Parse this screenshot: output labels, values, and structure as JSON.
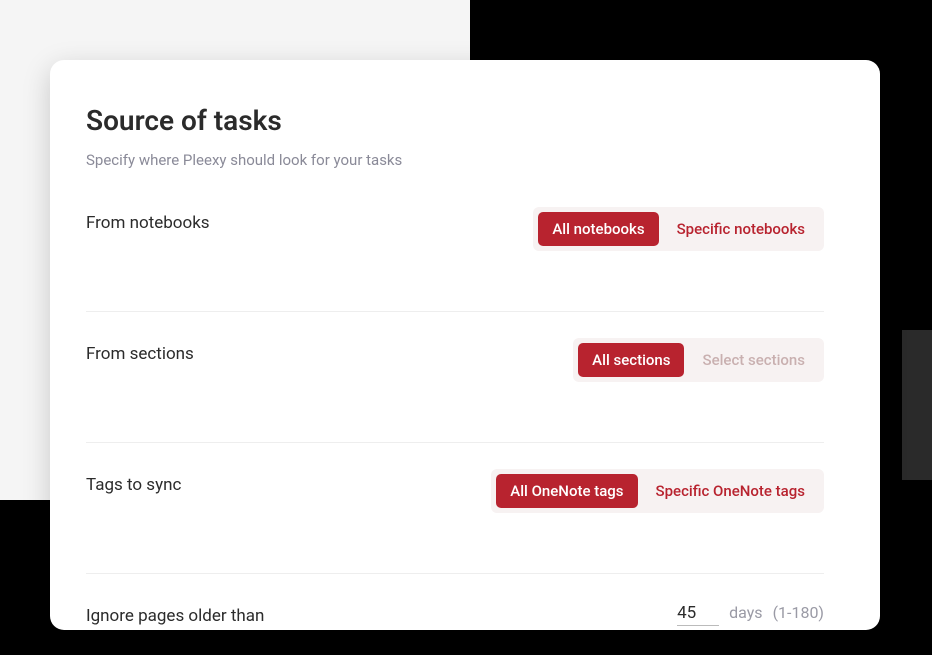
{
  "header": {
    "title": "Source of tasks",
    "subtitle": "Specify where Pleexy should look for your tasks"
  },
  "settings": {
    "notebooks": {
      "label": "From notebooks",
      "option_all": "All notebooks",
      "option_specific": "Specific notebooks"
    },
    "sections": {
      "label": "From sections",
      "option_all": "All sections",
      "option_specific": "Select sections"
    },
    "tags": {
      "label": "Tags to sync",
      "option_all": "All OneNote tags",
      "option_specific": "Specific OneNote tags"
    },
    "ignore": {
      "label": "Ignore pages older than",
      "value": "45",
      "unit": "days",
      "range": "(1-180)"
    }
  },
  "colors": {
    "accent": "#b8232f"
  }
}
